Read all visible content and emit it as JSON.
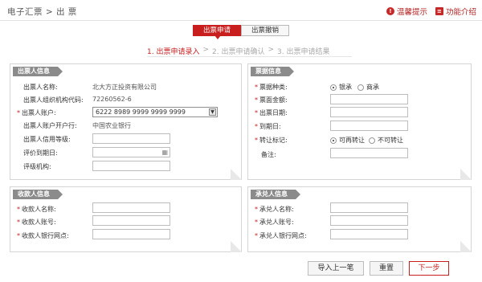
{
  "breadcrumb": "电子汇票 > 出 票",
  "header": {
    "tips_label": "温馨提示",
    "intro_label": "功能介绍"
  },
  "tabs": [
    {
      "label": "出票申请"
    },
    {
      "label": "出票撤销"
    }
  ],
  "steps": [
    "1. 出票申请录入",
    ">",
    "2. 出票申请确认",
    ">",
    "3. 出票申请结果"
  ],
  "drawer": {
    "title": "出票人信息",
    "name_label": "出票人名称:",
    "name_value": "北大方正投资有限公司",
    "org_code_label": "出票人组织机构代码:",
    "org_code_value": "72260562-6",
    "account_label": "出票人账户:",
    "account_value": "6222 8989 9999 9999 9999",
    "bank_label": "出票人账户开户行:",
    "bank_value": "中国农业银行",
    "credit_label": "出票人信用等级:",
    "rating_date_label": "评价到期日:",
    "rating_org_label": "评级机构:"
  },
  "bill": {
    "title": "票据信息",
    "type_label": "票据种类:",
    "type_options": [
      "银承",
      "商承"
    ],
    "amount_label": "票面金额:",
    "issue_date_label": "出票日期:",
    "due_date_label": "到期日:",
    "transfer_label": "转让标记:",
    "transfer_options": [
      "可再转让",
      "不可转让"
    ],
    "remark_label": "备注:"
  },
  "payee": {
    "title": "收款人信息",
    "name_label": "收款人名称:",
    "account_label": "收款人账号:",
    "bank_label": "收款人银行网点:"
  },
  "acceptor": {
    "title": "承兑人信息",
    "name_label": "承兑人名称:",
    "account_label": "承兑人账号:",
    "bank_label": "承兑人银行网点:"
  },
  "buttons": {
    "import_label": "导入上一笔",
    "reset_label": "重置",
    "next_label": "下一步"
  },
  "colors": {
    "accent": "#c81e1e",
    "panel_header": "#8b8b8b"
  }
}
